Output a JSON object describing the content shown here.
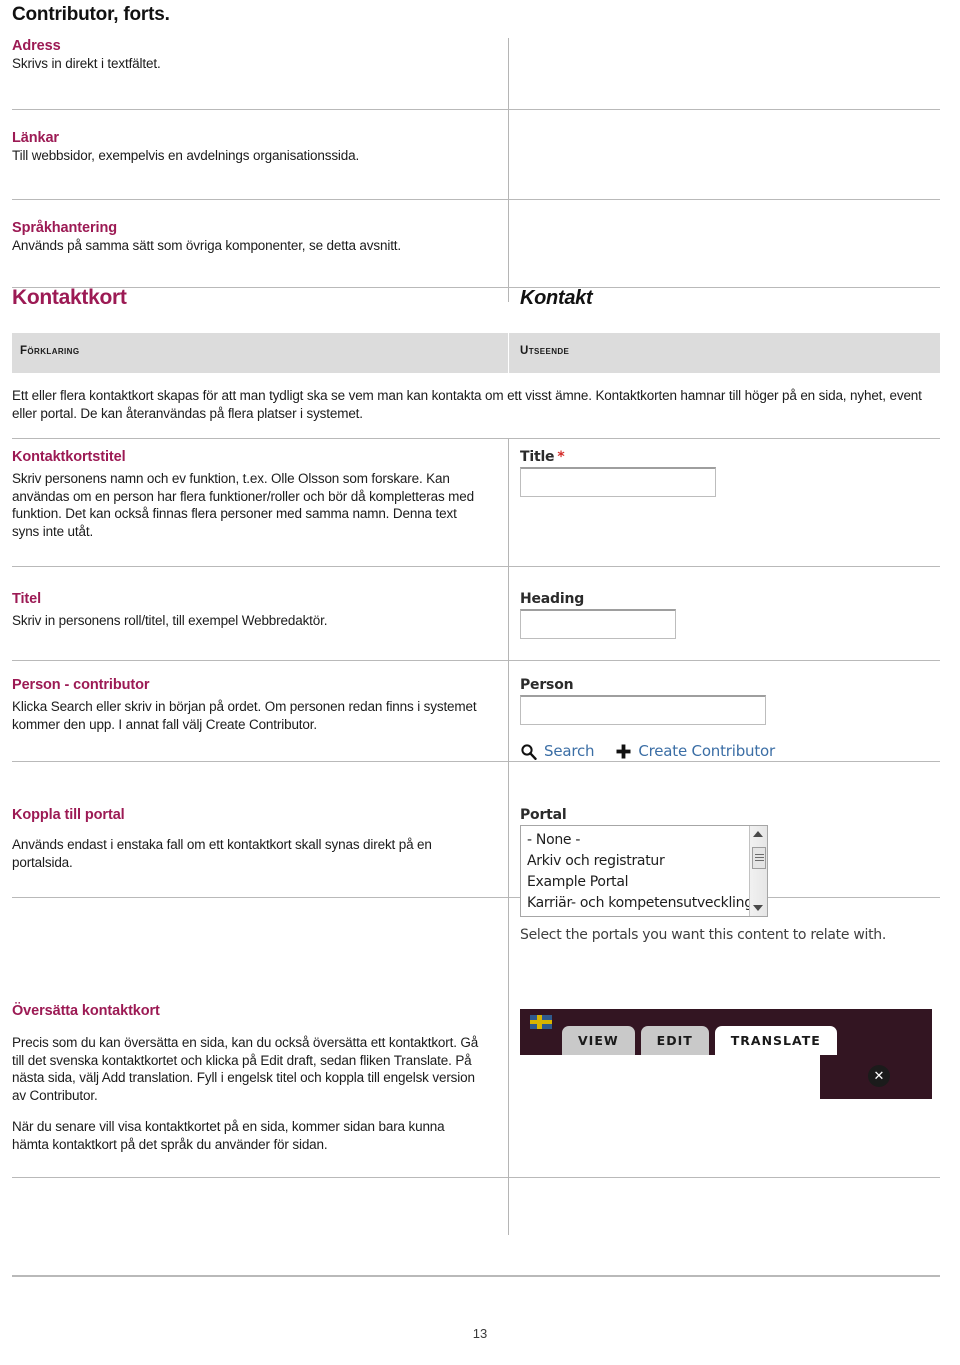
{
  "document": {
    "title": "Contributor, forts.",
    "page_number": "13",
    "accent_color": "#9c1a54",
    "link_color": "#3b6ea5",
    "required_color": "#d42b28"
  },
  "top_sections": [
    {
      "heading": "Adress",
      "body": "Skrivs in direkt i textfältet."
    },
    {
      "heading": "Länkar",
      "body": "Till webbsidor, exempelvis en avdelnings organisationssida."
    },
    {
      "heading": "Språkhantering",
      "body": "Används på samma sätt som övriga komponenter, se detta avsnitt."
    }
  ],
  "section": {
    "title_left": "Kontaktkort",
    "title_right": "Kontakt",
    "column_headers": {
      "left": "Förklaring",
      "right": "Utseende"
    },
    "intro": "Ett eller flera kontaktkort skapas för att man tydligt ska se vem man kan kontakta om ett visst ämne. Kontaktkorten hamnar till höger på en sida, nyhet, event eller portal. De kan återanvändas på flera platser i systemet."
  },
  "rows": {
    "kontaktkortstitel": {
      "heading": "Kontaktkortstitel",
      "body": "Skriv personens namn och ev funktion, t.ex. Olle Olsson som forskare. Kan användas om en person har flera funktioner/roller och bör då kompletteras med funktion. Det kan också finnas flera personer med samma namn. Denna text syns inte utåt.",
      "field_label": "Title",
      "field_required_mark": "*",
      "field_value": ""
    },
    "titel": {
      "heading": "Titel",
      "body": "Skriv in personens roll/titel, till exempel Webbredaktör.",
      "field_label": "Heading",
      "field_value": ""
    },
    "person": {
      "heading": "Person - contributor",
      "body": "Klicka Search eller skriv in början på ordet. Om personen redan finns i systemet kommer den upp. I annat fall välj Create Contributor.",
      "field_label": "Person",
      "field_value": "",
      "actions": [
        {
          "label": "Search",
          "icon": "search-icon"
        },
        {
          "label": "Create Contributor",
          "icon": "plus-icon"
        }
      ]
    },
    "portal": {
      "heading": "Koppla till portal",
      "body": "Används endast i enstaka fall om ett kontaktkort skall synas direkt på en portalsida.",
      "field_label": "Portal",
      "options": [
        "- None -",
        "Arkiv och registratur",
        "Example Portal",
        "Karriär- och kompetensutveckling"
      ],
      "help_text": "Select the portals you want this content to relate with."
    },
    "translate": {
      "heading": "Översätta kontaktkort",
      "body_1": "Precis som du kan översätta en sida, kan du också översätta ett kontaktkort. Gå till det svenska kontaktkortet och klicka på Edit draft, sedan fliken Translate. På nästa sida, välj Add translation. Fyll i engelsk titel och koppla till engelsk version av Contributor.",
      "body_2": "När du senare vill visa kontaktkortet på en sida, kommer sidan bara kunna hämta kontaktkort på det språk du använder för sidan.",
      "tabs": [
        {
          "label": "VIEW",
          "active": false
        },
        {
          "label": "EDIT",
          "active": false
        },
        {
          "label": "TRANSLATE",
          "active": true
        }
      ],
      "close_glyph": "✕"
    }
  }
}
